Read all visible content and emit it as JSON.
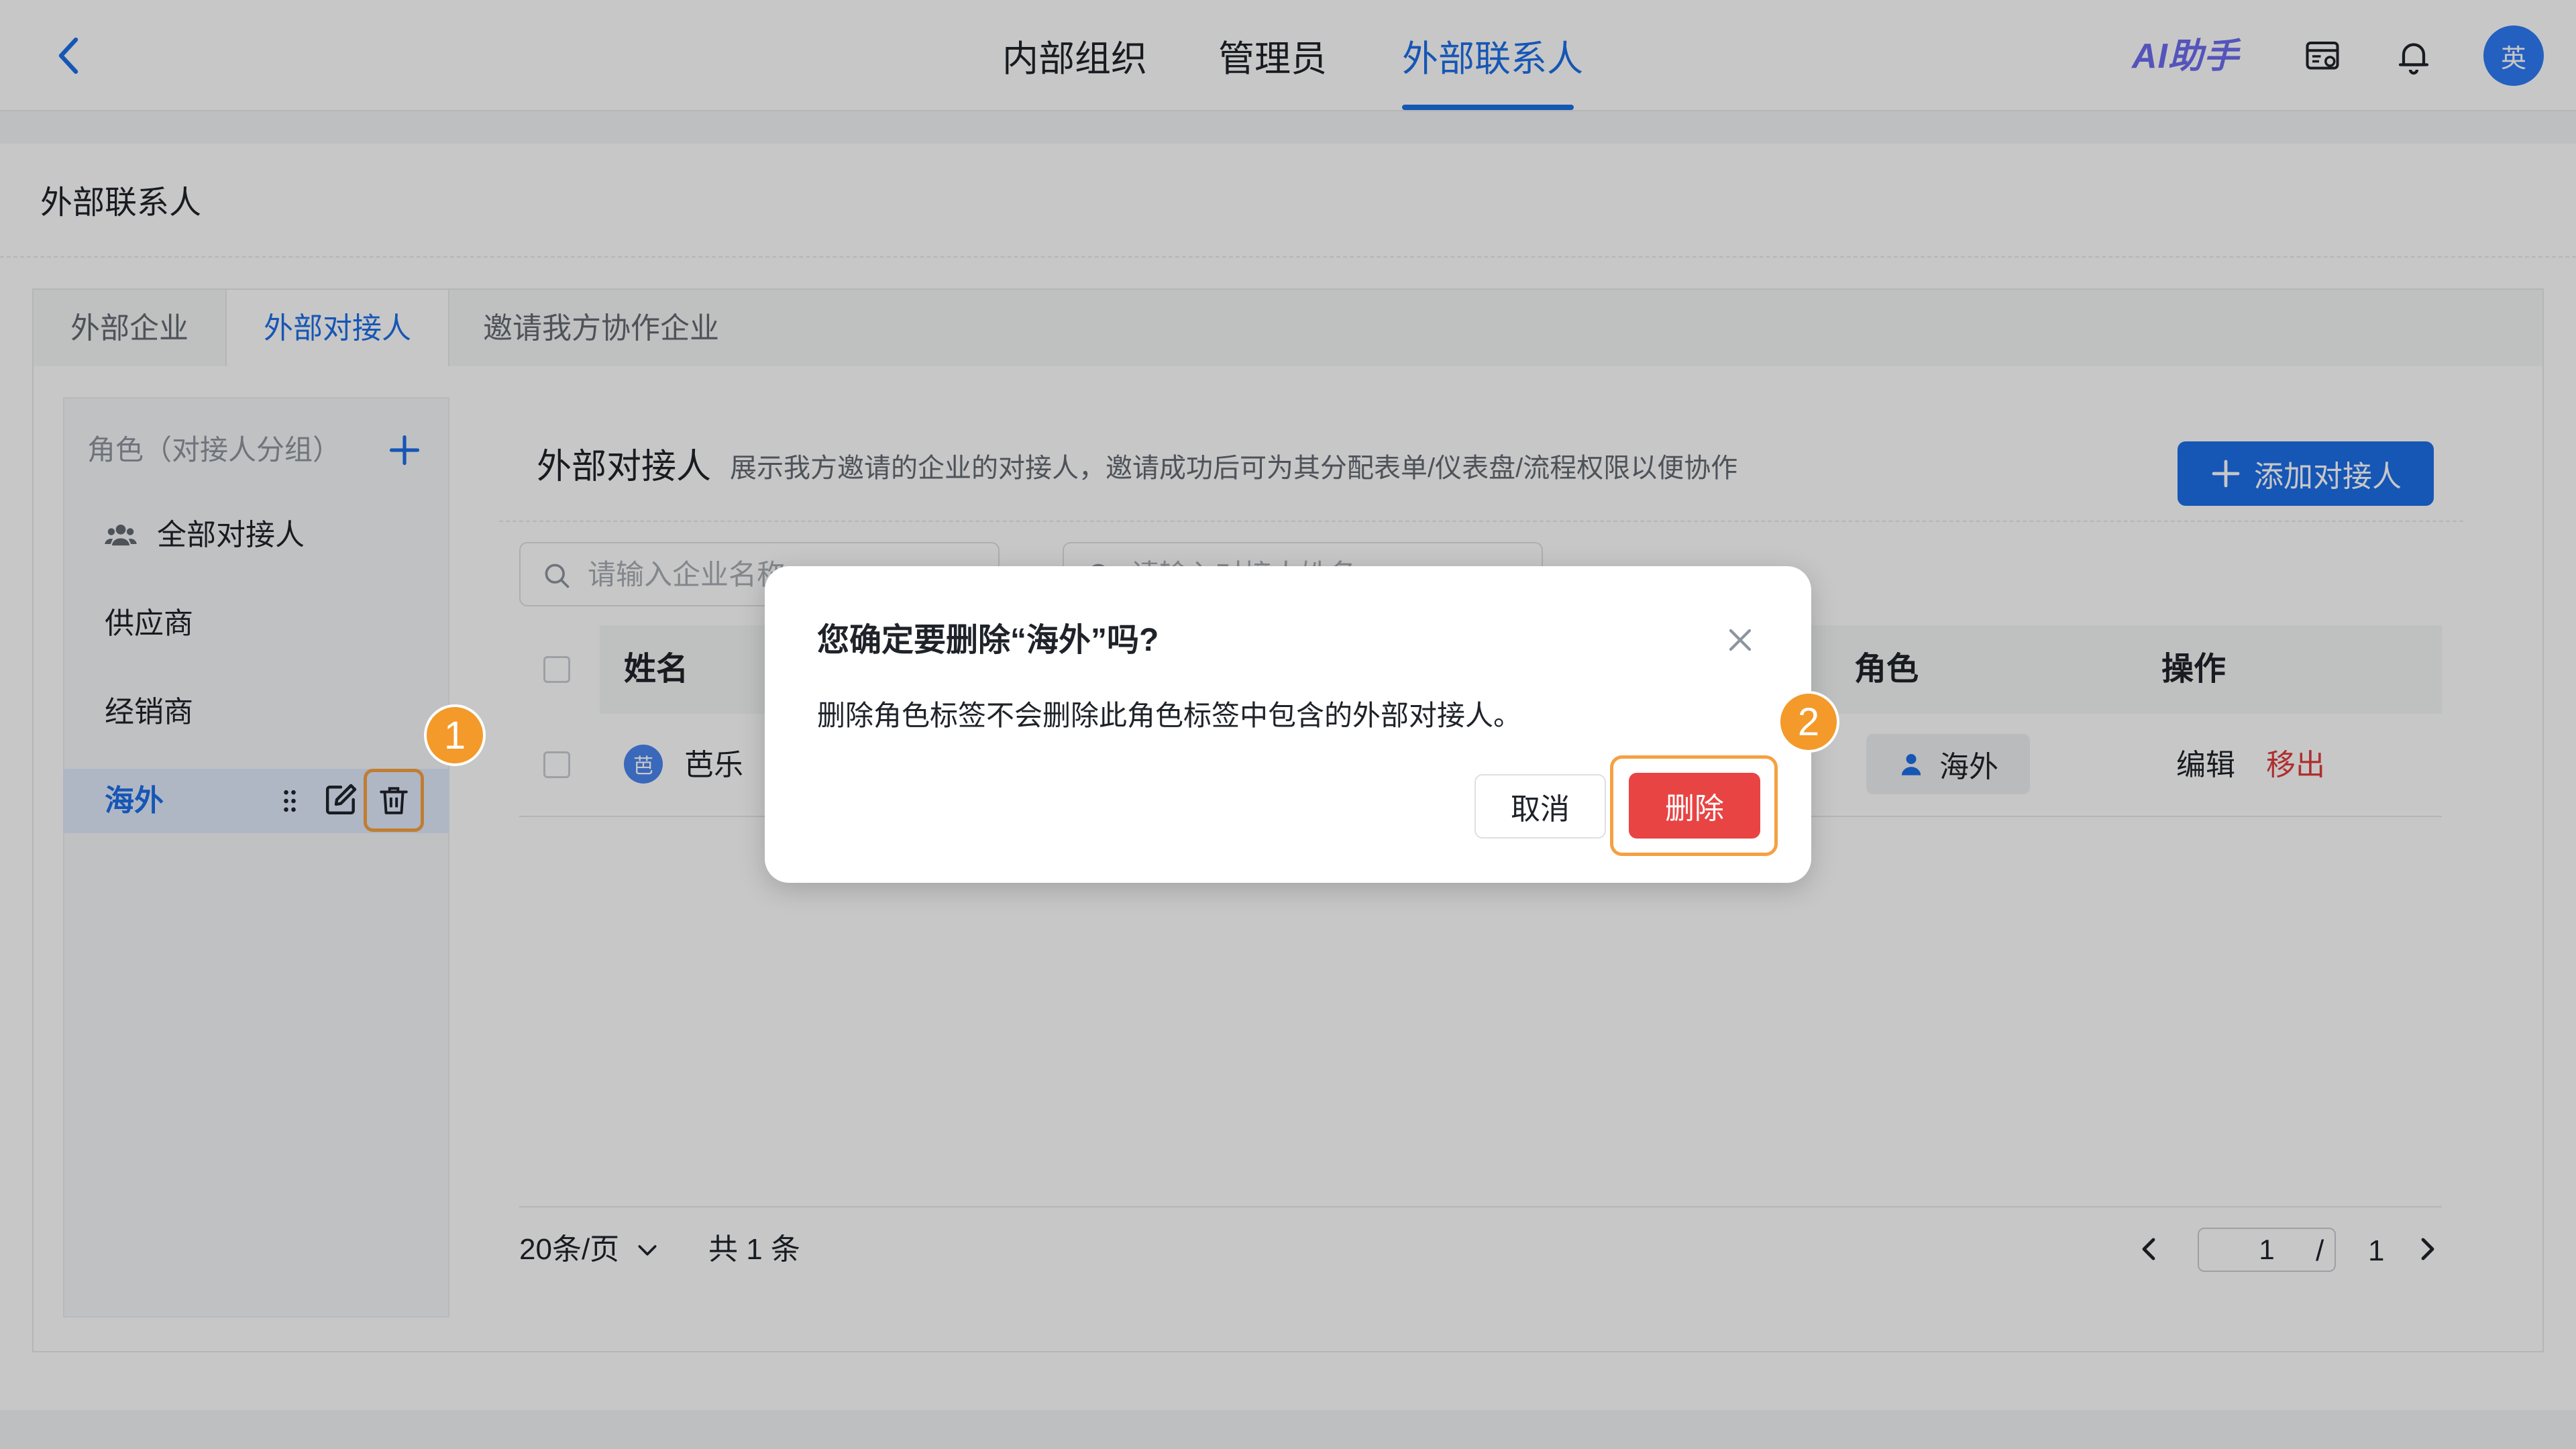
{
  "header": {
    "tabs": [
      {
        "label": "内部组织"
      },
      {
        "label": "管理员"
      },
      {
        "label": "外部联系人",
        "active": true
      }
    ],
    "ai_label": "AI助手",
    "avatar_text": "英",
    "icons": [
      "back-arrow-icon",
      "console-icon",
      "bell-icon"
    ]
  },
  "page": {
    "title": "外部联系人",
    "subtabs": [
      {
        "label": "外部企业"
      },
      {
        "label": "外部对接人",
        "active": true
      },
      {
        "label": "邀请我方协作企业"
      }
    ]
  },
  "sidebar": {
    "heading": "角色（对接人分组）",
    "items": [
      {
        "label": "全部对接人",
        "icon": "group-icon"
      },
      {
        "label": "供应商"
      },
      {
        "label": "经销商"
      },
      {
        "label": "海外",
        "active": true
      }
    ]
  },
  "main": {
    "title": "外部对接人",
    "description": "展示我方邀请的企业的对接人，邀请成功后可为其分配表单/仪表盘/流程权限以便协作",
    "add_button": "添加对接人",
    "search_company_placeholder": "请输入企业名称",
    "search_contact_placeholder": "请输入对接人姓名",
    "columns": {
      "name": "姓名",
      "role": "角色",
      "action": "操作"
    },
    "rows": [
      {
        "avatar": "芭",
        "name": "芭乐",
        "role": "海外",
        "actions": [
          "编辑",
          "移出"
        ]
      }
    ],
    "pagination": {
      "page_size": "20条/页",
      "total": "共 1 条",
      "current": "1",
      "separator": "/",
      "pages": "1"
    }
  },
  "dialog": {
    "title": "您确定要删除“海外”吗?",
    "body": "删除角色标签不会删除此角色标签中包含的外部对接人。",
    "cancel": "取消",
    "confirm": "删除"
  },
  "markers": [
    "1",
    "2"
  ],
  "colors": {
    "accent": "#1d6fe8",
    "danger": "#e84444",
    "marker": "#f39a2b"
  }
}
